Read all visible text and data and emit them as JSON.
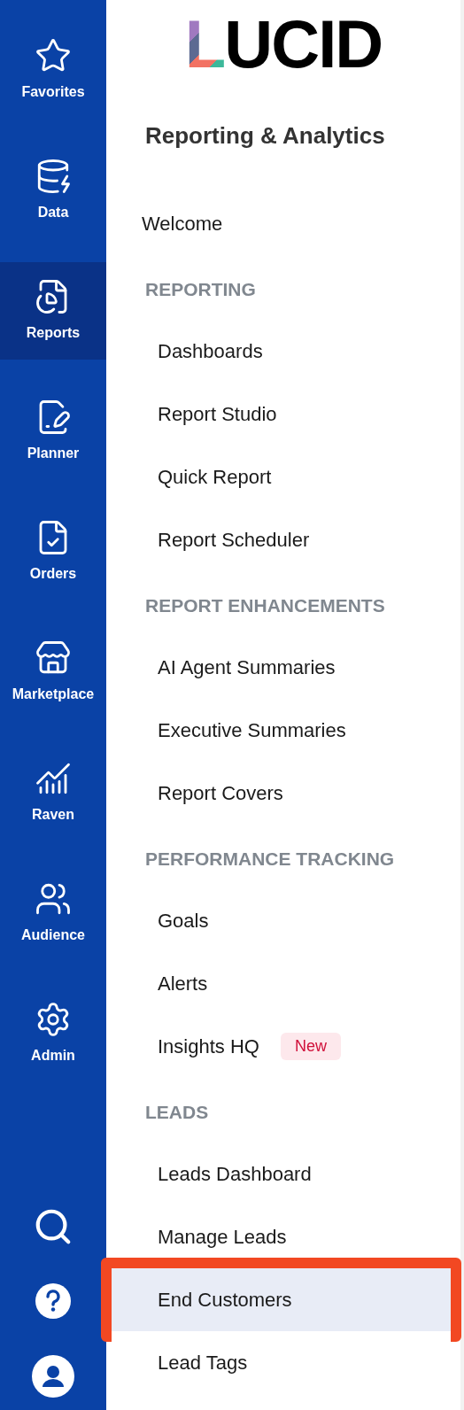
{
  "rail": {
    "items": [
      {
        "label": "Favorites",
        "selected": false
      },
      {
        "label": "Data",
        "selected": false
      },
      {
        "label": "Reports",
        "selected": true
      },
      {
        "label": "Planner",
        "selected": false
      },
      {
        "label": "Orders",
        "selected": false
      },
      {
        "label": "Marketplace",
        "selected": false
      },
      {
        "label": "Raven",
        "selected": false
      },
      {
        "label": "Audience",
        "selected": false
      },
      {
        "label": "Admin",
        "selected": false
      }
    ]
  },
  "logo": "LUCID",
  "title": "Reporting & Analytics",
  "welcome": {
    "label": "Welcome",
    "selected": false,
    "highlighted": false
  },
  "sections": [
    {
      "heading": "REPORTING",
      "items": [
        {
          "label": "Dashboards",
          "selected": false,
          "highlighted": false
        },
        {
          "label": "Report Studio",
          "selected": false,
          "highlighted": false
        },
        {
          "label": "Quick Report",
          "selected": false,
          "highlighted": false
        },
        {
          "label": "Report Scheduler",
          "selected": false,
          "highlighted": false
        }
      ]
    },
    {
      "heading": "REPORT ENHANCEMENTS",
      "items": [
        {
          "label": "AI Agent Summaries",
          "selected": false,
          "highlighted": false
        },
        {
          "label": "Executive Summaries",
          "selected": false,
          "highlighted": false
        },
        {
          "label": "Report Covers",
          "selected": false,
          "highlighted": false
        }
      ]
    },
    {
      "heading": "PERFORMANCE TRACKING",
      "items": [
        {
          "label": "Goals",
          "selected": false,
          "highlighted": false
        },
        {
          "label": "Alerts",
          "selected": false,
          "highlighted": false
        },
        {
          "label": "Insights HQ",
          "badge": "New",
          "selected": false,
          "highlighted": false
        }
      ]
    },
    {
      "heading": "LEADS",
      "items": [
        {
          "label": "Leads Dashboard",
          "selected": false,
          "highlighted": false
        },
        {
          "label": "Manage Leads",
          "selected": false,
          "highlighted": false
        },
        {
          "label": "End Customers",
          "selected": true,
          "highlighted": true
        },
        {
          "label": "Lead Tags",
          "selected": false,
          "highlighted": false
        }
      ]
    }
  ]
}
